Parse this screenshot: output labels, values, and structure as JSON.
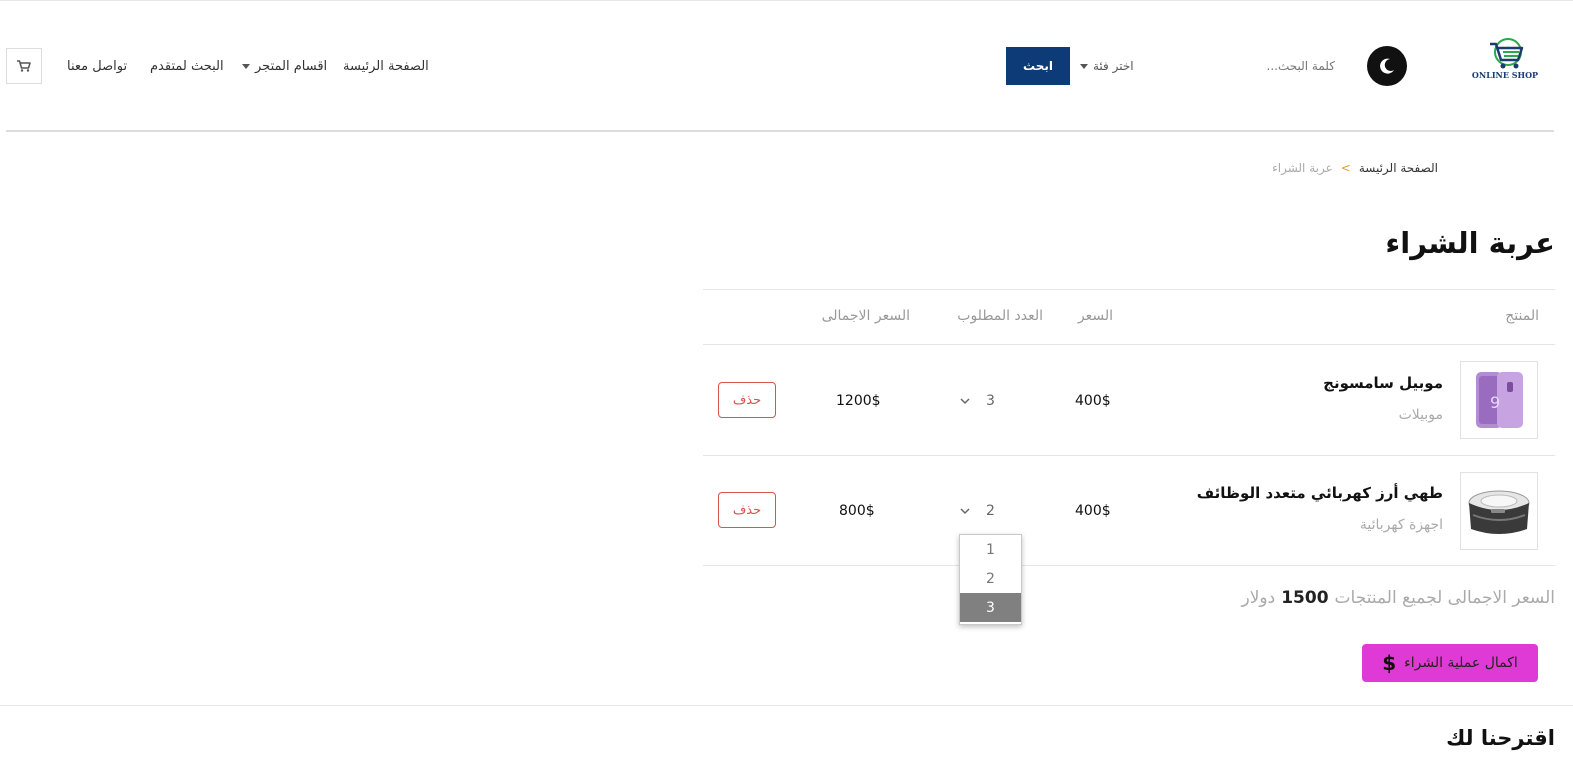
{
  "header": {
    "logo_text": "ONLINE SHOP",
    "search_placeholder": "كلمة البحث...",
    "category_select": "اختر فئة",
    "search_button": "ابحث",
    "nav": {
      "home": "الصفحة الرئيسة",
      "categories": "اقسام المتجر",
      "advanced_search": "البحث لمتقدم",
      "contact": "تواصل معنا"
    },
    "icons": {
      "theme": "moon-icon",
      "cart": "cart-icon",
      "logo": "shopping-cart-logo"
    },
    "colors": {
      "search_button_bg": "#0d3b78"
    }
  },
  "breadcrumb": {
    "home": "الصفحة الرئيسة",
    "separator": ">",
    "current": "عربة الشراء"
  },
  "page_title": "عربة الشراء",
  "table": {
    "headers": {
      "product": "المنتج",
      "price": "السعر",
      "quantity": "العدد المطلوب",
      "total": "السعر الاجمالى"
    },
    "rows": [
      {
        "name": "موبيل سامسونج",
        "category": "موبيلات",
        "price": "400$",
        "quantity": "3",
        "total": "1200$",
        "delete": "حذف",
        "image": "phone-image"
      },
      {
        "name": "طهي أرز كهربائي متعدد الوظائف",
        "category": "اجهزة كهربائية",
        "price": "400$",
        "quantity": "2",
        "total": "800$",
        "delete": "حذف",
        "image": "rice-cooker-image"
      }
    ],
    "quantity_options": [
      "1",
      "2",
      "3"
    ],
    "highlighted_option": "3"
  },
  "summary": {
    "label": "السعر الاجمالى لجميع المنتجات",
    "amount": "1500",
    "currency": "دولار"
  },
  "checkout": {
    "label": "اكمال عملية الشراء",
    "icon_text": "$",
    "color": "#e03ad6"
  },
  "suggestions_title": "اقترحنا لك",
  "colors": {
    "delete_border": "#d9534f",
    "breadcrumb_separator": "#e0a030"
  }
}
